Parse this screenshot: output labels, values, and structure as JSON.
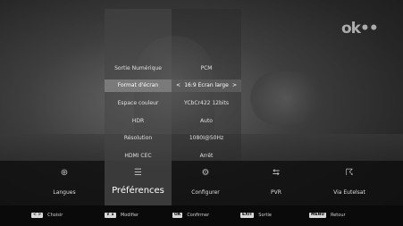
{
  "brand": {
    "logo_text": "ok••"
  },
  "settings": [
    {
      "label": "Sortie Numérique",
      "value": "PCM"
    },
    {
      "label": "Format d'écran",
      "value": "16:9 Ecran large",
      "selected": true
    },
    {
      "label": "Espace couleur",
      "value": "YCbCr422 12bits"
    },
    {
      "label": "HDR",
      "value": "Auto"
    },
    {
      "label": "Résolution",
      "value": "1080I@50Hz"
    },
    {
      "label": "HDMI CEC",
      "value": "Arrêt"
    }
  ],
  "arrows": {
    "left": "<",
    "right": ">"
  },
  "menu": [
    {
      "label": "Langues",
      "icon": "globe-icon",
      "glyph": "⊕"
    },
    {
      "label": "Préférences",
      "icon": "list-icon",
      "glyph": "☰",
      "active": true
    },
    {
      "label": "Configurer",
      "icon": "gear-icon",
      "glyph": "⚙"
    },
    {
      "label": "PVR",
      "icon": "usb-icon",
      "glyph": "⮀"
    },
    {
      "label": "Via Eutelsat",
      "icon": "satellite-icon",
      "glyph": "☈"
    }
  ],
  "hints": [
    {
      "key": "< >",
      "label": "Choisir"
    },
    {
      "key": "∨ ∧",
      "label": "Modifier"
    },
    {
      "key": "OK",
      "label": "Confirmer"
    },
    {
      "key": "EXIT",
      "label": "Sortie"
    },
    {
      "key": "MENU",
      "label": "Retour"
    }
  ]
}
